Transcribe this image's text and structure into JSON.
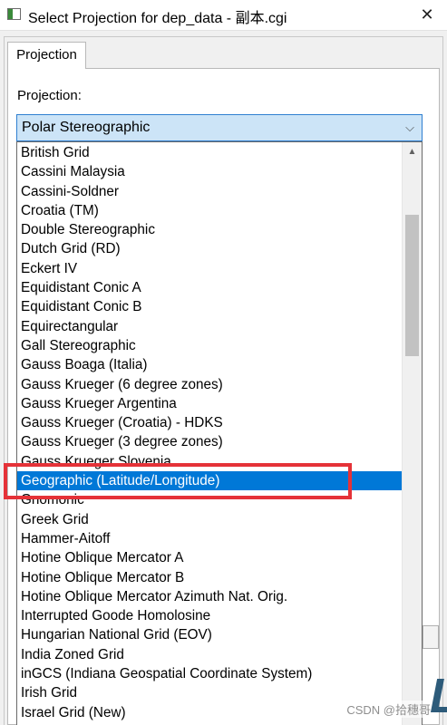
{
  "window": {
    "title": "Select Projection for dep_data - 副本.cgi",
    "close_glyph": "✕"
  },
  "tabs": [
    {
      "label": "Projection",
      "active": true
    }
  ],
  "form": {
    "projection_label": "Projection:",
    "combo_value": "Polar Stereographic",
    "combo_arrow": "⌵"
  },
  "dropdown": {
    "selected_index": 17,
    "items": [
      "British Grid",
      "Cassini Malaysia",
      "Cassini-Soldner",
      "Croatia (TM)",
      "Double Stereographic",
      "Dutch Grid (RD)",
      "Eckert IV",
      "Equidistant Conic A",
      "Equidistant Conic B",
      "Equirectangular",
      "Gall Stereographic",
      "Gauss Boaga (Italia)",
      "Gauss Krueger (6 degree zones)",
      "Gauss Krueger Argentina",
      "Gauss Krueger (Croatia) - HDKS",
      "Gauss Krueger (3 degree zones)",
      "Gauss Krueger Slovenia",
      "Geographic (Latitude/Longitude)",
      "Gnomonic",
      "Greek Grid",
      "Hammer-Aitoff",
      "Hotine Oblique Mercator A",
      "Hotine Oblique Mercator B",
      "Hotine Oblique Mercator Azimuth Nat. Orig.",
      "Interrupted Goode Homolosine",
      "Hungarian National Grid (EOV)",
      "India Zoned Grid",
      "inGCS (Indiana Geospatial Coordinate System)",
      "Irish Grid",
      "Israel Grid (New)"
    ],
    "scroll_up_glyph": "▲"
  },
  "colors": {
    "selection": "#0078d7",
    "highlight_box": "#e53238",
    "combo_bg": "#cce4f7"
  },
  "background_glyph": "L",
  "watermark": "CSDN @拾穗哥"
}
